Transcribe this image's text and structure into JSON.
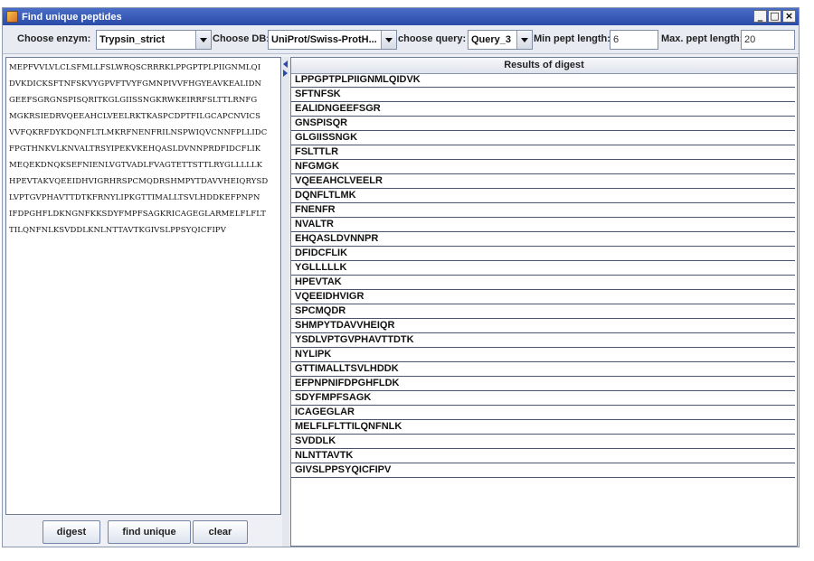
{
  "window": {
    "title": "Find unique peptides",
    "controls": [
      "_",
      "□",
      "×"
    ]
  },
  "toolbar": {
    "enzyme_label": "Choose enzym:",
    "enzyme_value": "Trypsin_strict",
    "db_label": "Choose DB:",
    "db_value": "UniProt/Swiss-ProtH...",
    "query_label": "choose query:",
    "query_value": "Query_3",
    "min_label": "Min pept length:",
    "min_value": "6",
    "max_label": "Max. pept length:",
    "max_value": "20"
  },
  "sequence_lines": [
    "MEPFVVLVLCLSFMLLFSLWRQSCRRRKLPPGPTPLPIIGNMLQI",
    "DVKDICKSFTNFSKVYGPVFTVYFGMNPIVVFHGYEAVKEALIDN",
    "GEEFSGRGNSPISQRITKGLGIISSNGKRWKEIRRFSLTTLRNFG",
    "MGKRSIEDRVQEEAHCLVEELRKTKASPCDPTFILGCAPCNVICS",
    "VVFQKRFDYKDQNFLTLMKRFNENFRILNSPWIQVCNNFPLLIDC",
    "FPGTHNKVLKNVALTRSYIPEKVKEHQASLDVNNPRDFIDCFLIK",
    "MEQEKDNQKSEFNIENLVGTVADLFVAGTETTSTTLRYGLLLLLK",
    "HPEVTAKVQEEIDHVIGRHRSPCMQDRSHMPYTDAVVHEIQRYSD",
    "LVPTGVPHAVTTDTKFRNYLIPKGTTIMALLTSVLHDDKEFPNPN",
    "IFDPGHFLDKNGNFKKSDYFMPFSAGKRICAGEGLARMELFLFLT",
    "TILQNFNLKSVDDLKNLNTTAVTKGIVSLPPSYQICFIPV"
  ],
  "buttons": {
    "digest": "digest",
    "find_unique": "find unique",
    "clear": "clear"
  },
  "results": {
    "header": "Results of digest",
    "rows": [
      "LPPGPTPLPIIGNMLQIDVK",
      "SFTNFSK",
      "EALIDNGEEFSGR",
      "GNSPISQR",
      "GLGIISSNGK",
      "FSLTTLR",
      "NFGMGK",
      "VQEEAHCLVEELR",
      "DQNFLTLMK",
      "FNENFR",
      "NVALTR",
      "EHQASLDVNNPR",
      "DFIDCFLIK",
      "YGLLLLLK",
      "HPEVTAK",
      "VQEEIDHVIGR",
      "SPCMQDR",
      "SHMPYTDAVVHEIQR",
      "YSDLVPTGVPHAVTTDTK",
      "NYLIPK",
      "GTTIMALLTSVLHDDK",
      "EFPNPNIFDPGHFLDK",
      "SDYFMPFSAGK",
      "ICAGEGLAR",
      "MELFLFLTTILQNFNLK",
      "SVDDLK",
      "NLNTTAVTK",
      "GIVSLPPSYQICFIPV"
    ]
  }
}
